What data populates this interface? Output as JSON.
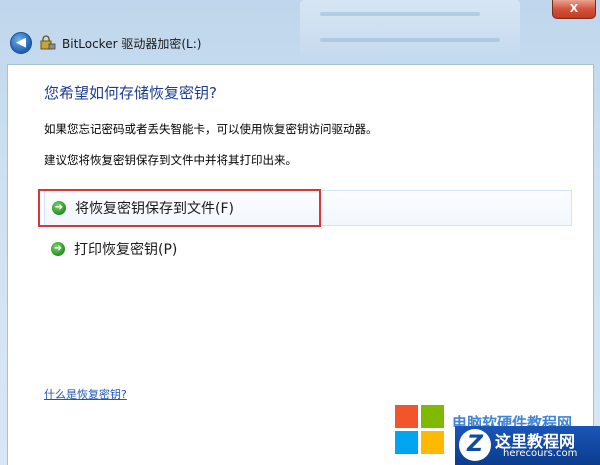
{
  "window": {
    "title": "BitLocker 驱动器加密(L:)",
    "close_glyph": "X",
    "back_glyph": "◀"
  },
  "main": {
    "heading": "您希望如何存储恢复密钥?",
    "description_1": "如果您忘记密码或者丢失智能卡，可以使用恢复密钥访问驱动器。",
    "description_2": "建议您将恢复密钥保存到文件中并将其打印出来。",
    "options": [
      {
        "label": "将恢复密钥保存到文件(F)",
        "icon": "green-arrow-icon"
      },
      {
        "label": "打印恢复密钥(P)",
        "icon": "green-arrow-icon"
      }
    ],
    "help_link": "什么是恢复密钥?"
  },
  "watermark": {
    "partial_text": "电脑软硬件教程网",
    "badge_letter": "Z",
    "badge_text": "这里教程网",
    "badge_url": "herecours.com"
  },
  "colors": {
    "heading": "#1e3d8f",
    "highlight": "#d6373b",
    "link": "#1f55b8"
  }
}
